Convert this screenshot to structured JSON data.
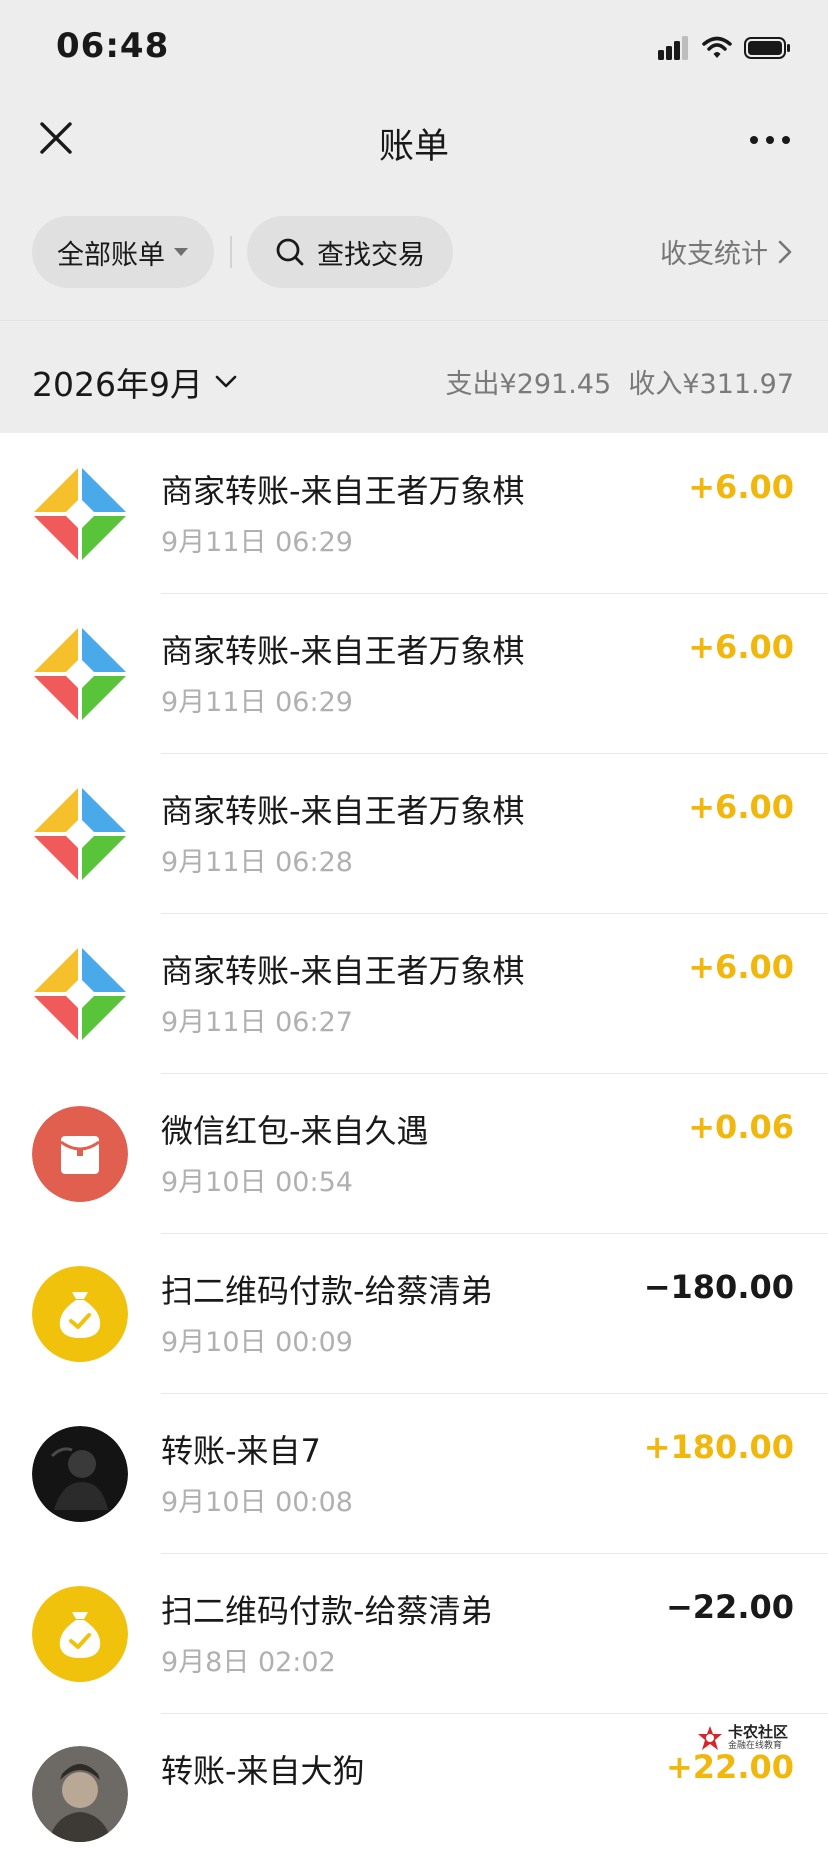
{
  "status_bar": {
    "time": "06:48"
  },
  "nav": {
    "title": "账单"
  },
  "filters": {
    "all_bills_label": "全部账单",
    "search_label": "查找交易",
    "stats_label": "收支统计"
  },
  "month": {
    "label": "2026年9月",
    "expense": "支出¥291.45",
    "income": "收入¥311.97"
  },
  "transactions": [
    {
      "title": "商家转账-来自王者万象棋",
      "time": "9月11日 06:29",
      "amount": "+6.00",
      "direction": "in",
      "icon": "game-pinwheel-logo"
    },
    {
      "title": "商家转账-来自王者万象棋",
      "time": "9月11日 06:29",
      "amount": "+6.00",
      "direction": "in",
      "icon": "game-pinwheel-logo"
    },
    {
      "title": "商家转账-来自王者万象棋",
      "time": "9月11日 06:28",
      "amount": "+6.00",
      "direction": "in",
      "icon": "game-pinwheel-logo"
    },
    {
      "title": "商家转账-来自王者万象棋",
      "time": "9月11日 06:27",
      "amount": "+6.00",
      "direction": "in",
      "icon": "game-pinwheel-logo"
    },
    {
      "title": "微信红包-来自久遇",
      "time": "9月10日 00:54",
      "amount": "+0.06",
      "direction": "in",
      "icon": "red-packet-icon"
    },
    {
      "title": "扫二维码付款-给蔡清弟",
      "time": "9月10日 00:09",
      "amount": "−180.00",
      "direction": "out",
      "icon": "money-bag-icon"
    },
    {
      "title": "转账-来自7",
      "time": "9月10日 00:08",
      "amount": "+180.00",
      "direction": "in",
      "icon": "user-photo-avatar"
    },
    {
      "title": "扫二维码付款-给蔡清弟",
      "time": "9月8日 02:02",
      "amount": "−22.00",
      "direction": "out",
      "icon": "money-bag-icon"
    },
    {
      "title": "转账-来自大狗",
      "time": "",
      "amount": "+22.00",
      "direction": "in",
      "icon": "user-photo-avatar"
    }
  ],
  "watermark": {
    "main": "卡农社区",
    "sub": "金融在线教育"
  },
  "colors": {
    "header_bg": "#ededed",
    "income": "#f2b70c",
    "expense": "#191919",
    "red_packet": "#e05f4f",
    "money_bag": "#f0c20c"
  }
}
